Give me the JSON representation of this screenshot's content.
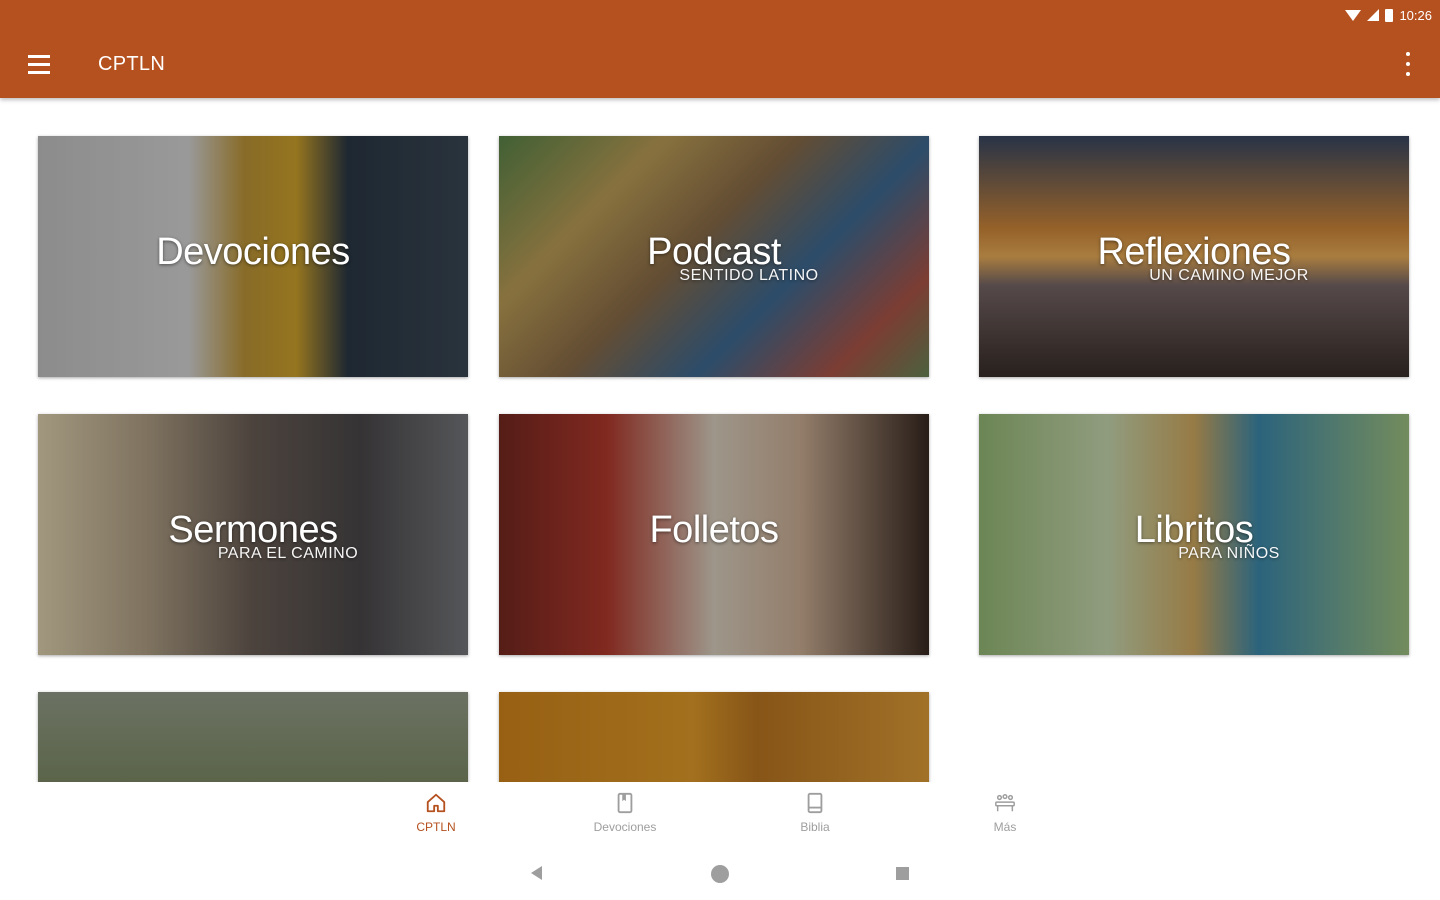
{
  "status_bar": {
    "time": "10:26"
  },
  "app_bar": {
    "title": "CPTLN"
  },
  "cards": [
    {
      "title": "Devociones",
      "subtitle": ""
    },
    {
      "title": "Podcast",
      "subtitle": "SENTIDO LATINO"
    },
    {
      "title": "Reflexiones",
      "subtitle": "UN CAMINO MEJOR"
    },
    {
      "title": "Sermones",
      "subtitle": "PARA EL CAMINO"
    },
    {
      "title": "Folletos",
      "subtitle": ""
    },
    {
      "title": "Libritos",
      "subtitle": "PARA NIÑOS"
    },
    {
      "title": "",
      "subtitle": ""
    },
    {
      "title": "",
      "subtitle": ""
    }
  ],
  "bottom_nav": [
    {
      "label": "CPTLN",
      "icon": "home-icon",
      "active": true
    },
    {
      "label": "Devociones",
      "icon": "book-icon",
      "active": false
    },
    {
      "label": "Biblia",
      "icon": "bible-icon",
      "active": false
    },
    {
      "label": "Más",
      "icon": "group-icon",
      "active": false
    }
  ],
  "colors": {
    "primary": "#B5501F",
    "inactive": "#9e9e9e"
  }
}
